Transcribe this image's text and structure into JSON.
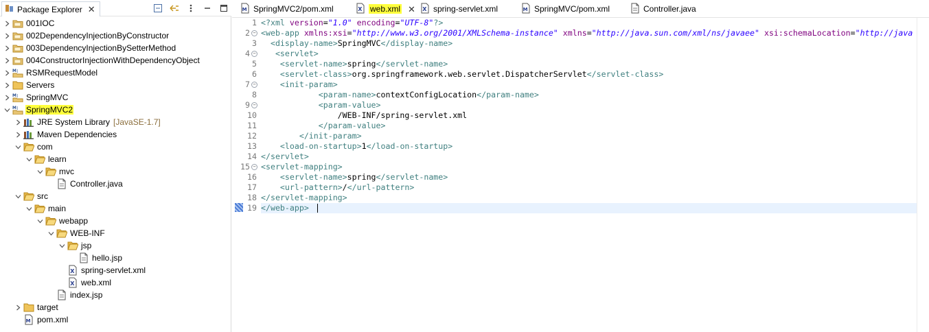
{
  "explorer": {
    "title": "Package Explorer",
    "tree": [
      {
        "label": "001IOC",
        "indent": 0,
        "expanded": false,
        "icon": "project-icon"
      },
      {
        "label": "002DependencyInjectionByConstructor",
        "indent": 0,
        "expanded": false,
        "icon": "project-icon"
      },
      {
        "label": "003DependencyInjectionBySetterMethod",
        "indent": 0,
        "expanded": false,
        "icon": "project-icon"
      },
      {
        "label": "004ConstructorInjectionWithDependencyObject",
        "indent": 0,
        "expanded": false,
        "icon": "project-icon"
      },
      {
        "label": "RSMRequestModel",
        "indent": 0,
        "expanded": false,
        "icon": "maven-project-icon"
      },
      {
        "label": "Servers",
        "indent": 0,
        "expanded": false,
        "icon": "folder-icon"
      },
      {
        "label": "SpringMVC",
        "indent": 0,
        "expanded": false,
        "icon": "maven-project-icon"
      },
      {
        "label": "SpringMVC2",
        "indent": 0,
        "expanded": true,
        "icon": "maven-project-icon",
        "highlight": true
      },
      {
        "label": "JRE System Library",
        "suffix": "[JavaSE-1.7]",
        "indent": 1,
        "expanded": false,
        "icon": "library-icon"
      },
      {
        "label": "Maven Dependencies",
        "indent": 1,
        "expanded": false,
        "icon": "library-icon"
      },
      {
        "label": "com",
        "indent": 1,
        "expanded": true,
        "icon": "folder-open-icon"
      },
      {
        "label": "learn",
        "indent": 2,
        "expanded": true,
        "icon": "folder-open-icon"
      },
      {
        "label": "mvc",
        "indent": 3,
        "expanded": true,
        "icon": "folder-open-icon"
      },
      {
        "label": "Controller.java",
        "indent": 4,
        "leaf": true,
        "icon": "file-icon"
      },
      {
        "label": "src",
        "indent": 1,
        "expanded": true,
        "icon": "folder-open-icon"
      },
      {
        "label": "main",
        "indent": 2,
        "expanded": true,
        "icon": "folder-open-icon"
      },
      {
        "label": "webapp",
        "indent": 3,
        "expanded": true,
        "icon": "folder-open-icon"
      },
      {
        "label": "WEB-INF",
        "indent": 4,
        "expanded": true,
        "icon": "folder-open-icon"
      },
      {
        "label": "jsp",
        "indent": 5,
        "expanded": true,
        "icon": "folder-open-icon"
      },
      {
        "label": "hello.jsp",
        "indent": 6,
        "leaf": true,
        "icon": "file-icon"
      },
      {
        "label": "spring-servlet.xml",
        "indent": 5,
        "leaf": true,
        "icon": "xml-file-icon"
      },
      {
        "label": "web.xml",
        "indent": 5,
        "leaf": true,
        "icon": "xml-file-icon"
      },
      {
        "label": "index.jsp",
        "indent": 4,
        "leaf": true,
        "icon": "file-icon"
      },
      {
        "label": "target",
        "indent": 1,
        "expanded": false,
        "icon": "folder-icon"
      },
      {
        "label": "pom.xml",
        "indent": 1,
        "leaf": true,
        "icon": "maven-file-icon"
      }
    ]
  },
  "editor": {
    "tabs": [
      {
        "label": "SpringMVC2/pom.xml",
        "icon": "maven-file-icon",
        "active": false
      },
      {
        "label": "web.xml",
        "icon": "xml-file-icon",
        "active": true,
        "highlight": true
      },
      {
        "label": "spring-servlet.xml",
        "icon": "xml-file-icon",
        "active": false
      },
      {
        "label": "SpringMVC/pom.xml",
        "icon": "maven-file-icon",
        "active": false
      },
      {
        "label": "Controller.java",
        "icon": "file-icon",
        "active": false
      }
    ],
    "lines": [
      {
        "n": "1",
        "tokens": [
          [
            "pi",
            "<?xml "
          ],
          [
            "attr",
            "version"
          ],
          [
            "txt",
            "="
          ],
          [
            "val",
            "\"1.0\""
          ],
          [
            "txt",
            " "
          ],
          [
            "attr",
            "encoding"
          ],
          [
            "txt",
            "="
          ],
          [
            "val",
            "\"UTF-8\""
          ],
          [
            "pi",
            "?>"
          ]
        ]
      },
      {
        "n": "2",
        "fold": true,
        "tokens": [
          [
            "tag",
            "<web-app "
          ],
          [
            "attr",
            "xmlns:xsi"
          ],
          [
            "txt",
            "="
          ],
          [
            "val",
            "\"http://www.w3.org/2001/XMLSchema-instance\""
          ],
          [
            "txt",
            " "
          ],
          [
            "attr",
            "xmlns"
          ],
          [
            "txt",
            "="
          ],
          [
            "val",
            "\"http://java.sun.com/xml/ns/javaee\""
          ],
          [
            "txt",
            " "
          ],
          [
            "attr",
            "xsi:schemaLocation"
          ],
          [
            "txt",
            "="
          ],
          [
            "val",
            "\"http://java"
          ]
        ]
      },
      {
        "n": "3",
        "tokens": [
          [
            "txt",
            "  "
          ],
          [
            "tag",
            "<display-name>"
          ],
          [
            "txt",
            "SpringMVC"
          ],
          [
            "tag",
            "</display-name>"
          ]
        ]
      },
      {
        "n": "4",
        "fold": true,
        "tokens": [
          [
            "txt",
            "   "
          ],
          [
            "tag",
            "<servlet>"
          ]
        ]
      },
      {
        "n": "5",
        "tokens": [
          [
            "txt",
            "    "
          ],
          [
            "tag",
            "<servlet-name>"
          ],
          [
            "txt",
            "spring"
          ],
          [
            "tag",
            "</servlet-name>"
          ]
        ]
      },
      {
        "n": "6",
        "tokens": [
          [
            "txt",
            "    "
          ],
          [
            "tag",
            "<servlet-class>"
          ],
          [
            "txt",
            "org.springframework.web.servlet.DispatcherServlet"
          ],
          [
            "tag",
            "</servlet-class>"
          ]
        ]
      },
      {
        "n": "7",
        "fold": true,
        "tokens": [
          [
            "txt",
            "    "
          ],
          [
            "tag",
            "<init-param>"
          ]
        ]
      },
      {
        "n": "8",
        "tokens": [
          [
            "txt",
            "            "
          ],
          [
            "tag",
            "<param-name>"
          ],
          [
            "txt",
            "contextConfigLocation"
          ],
          [
            "tag",
            "</param-name>"
          ]
        ]
      },
      {
        "n": "9",
        "fold": true,
        "tokens": [
          [
            "txt",
            "            "
          ],
          [
            "tag",
            "<param-value>"
          ]
        ]
      },
      {
        "n": "10",
        "tokens": [
          [
            "txt",
            "                /WEB-INF/spring-servlet.xml"
          ]
        ]
      },
      {
        "n": "11",
        "tokens": [
          [
            "txt",
            "            "
          ],
          [
            "tag",
            "</param-value>"
          ]
        ]
      },
      {
        "n": "12",
        "tokens": [
          [
            "txt",
            "        "
          ],
          [
            "tag",
            "</init-param>"
          ]
        ]
      },
      {
        "n": "13",
        "tokens": [
          [
            "txt",
            "    "
          ],
          [
            "tag",
            "<load-on-startup>"
          ],
          [
            "txt",
            "1"
          ],
          [
            "tag",
            "</load-on-startup>"
          ]
        ]
      },
      {
        "n": "14",
        "tokens": [
          [
            "tag",
            "</servlet>"
          ]
        ]
      },
      {
        "n": "15",
        "fold": true,
        "tokens": [
          [
            "tag",
            "<servlet-mapping>"
          ]
        ]
      },
      {
        "n": "16",
        "tokens": [
          [
            "txt",
            "    "
          ],
          [
            "tag",
            "<servlet-name>"
          ],
          [
            "txt",
            "spring"
          ],
          [
            "tag",
            "</servlet-name>"
          ]
        ]
      },
      {
        "n": "17",
        "tokens": [
          [
            "txt",
            "    "
          ],
          [
            "tag",
            "<url-pattern>"
          ],
          [
            "txt",
            "/"
          ],
          [
            "tag",
            "</url-pattern>"
          ]
        ]
      },
      {
        "n": "18",
        "tokens": [
          [
            "tag",
            "</servlet-mapping>"
          ]
        ]
      },
      {
        "n": "19",
        "current": true,
        "tokens": [
          [
            "tag",
            "</web-app>"
          ]
        ]
      }
    ]
  },
  "colors": {
    "highlight": "#ffff3c",
    "tag": "#3f7f7f",
    "attr": "#7f007f",
    "value": "#2a00ff",
    "current_line": "#e8f2fe"
  }
}
